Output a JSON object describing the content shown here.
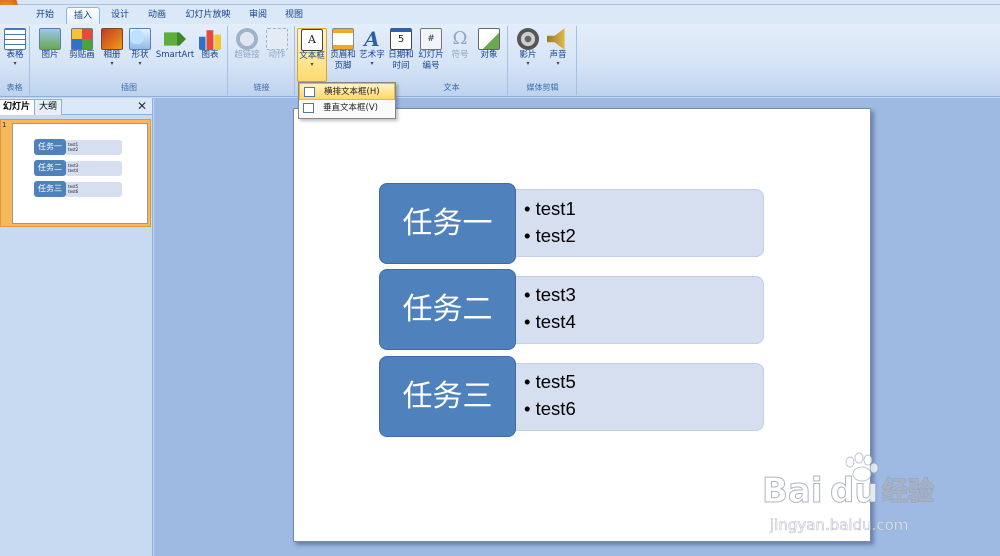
{
  "tabs": [
    {
      "label": "开始",
      "active": false
    },
    {
      "label": "插入",
      "active": true
    },
    {
      "label": "设计",
      "active": false
    },
    {
      "label": "动画",
      "active": false
    },
    {
      "label": "幻灯片放映",
      "active": false
    },
    {
      "label": "审阅",
      "active": false
    },
    {
      "label": "视图",
      "active": false
    }
  ],
  "ribbon": {
    "groups": {
      "table": "表格",
      "illustrations": "插图",
      "links": "链接",
      "text": "文本",
      "media": "媒体剪辑"
    },
    "buttons": {
      "table": "表格",
      "picture": "图片",
      "clipart": "剪贴画",
      "album": "相册",
      "shapes": "形状",
      "smartart": "SmartArt",
      "chart": "图表",
      "hyperlink": "超链接",
      "action": "动作",
      "textbox": "文本框",
      "header_footer_1": "页眉和",
      "header_footer_2": "页脚",
      "wordart": "艺术字",
      "datetime_1": "日期和",
      "datetime_2": "时间",
      "slide_number_1": "幻灯片",
      "slide_number_2": "编号",
      "symbol": "符号",
      "object": "对象",
      "movie": "影片",
      "sound": "声音"
    }
  },
  "dropdown": {
    "items": [
      {
        "label": "横排文本框(H)",
        "highlighted": true
      },
      {
        "label": "垂直文本框(V)",
        "highlighted": false
      }
    ]
  },
  "left_pane": {
    "tab_slides": "幻灯片",
    "tab_outline": "大纲",
    "close": "✕",
    "slide_number": "1"
  },
  "slide": {
    "tasks": [
      {
        "title": "任务一",
        "items": [
          "test1",
          "test2"
        ]
      },
      {
        "title": "任务二",
        "items": [
          "test3",
          "test4"
        ]
      },
      {
        "title": "任务三",
        "items": [
          "test5",
          "test6"
        ]
      }
    ]
  },
  "watermark": {
    "brand": "Bai",
    "brand_du": "du",
    "cn": "经验",
    "url": "jingyan.baidu.com"
  },
  "colors": {
    "key_fill": "#4f81bd",
    "bar_fill": "#d5dff0",
    "ribbon_text": "#15428b"
  }
}
